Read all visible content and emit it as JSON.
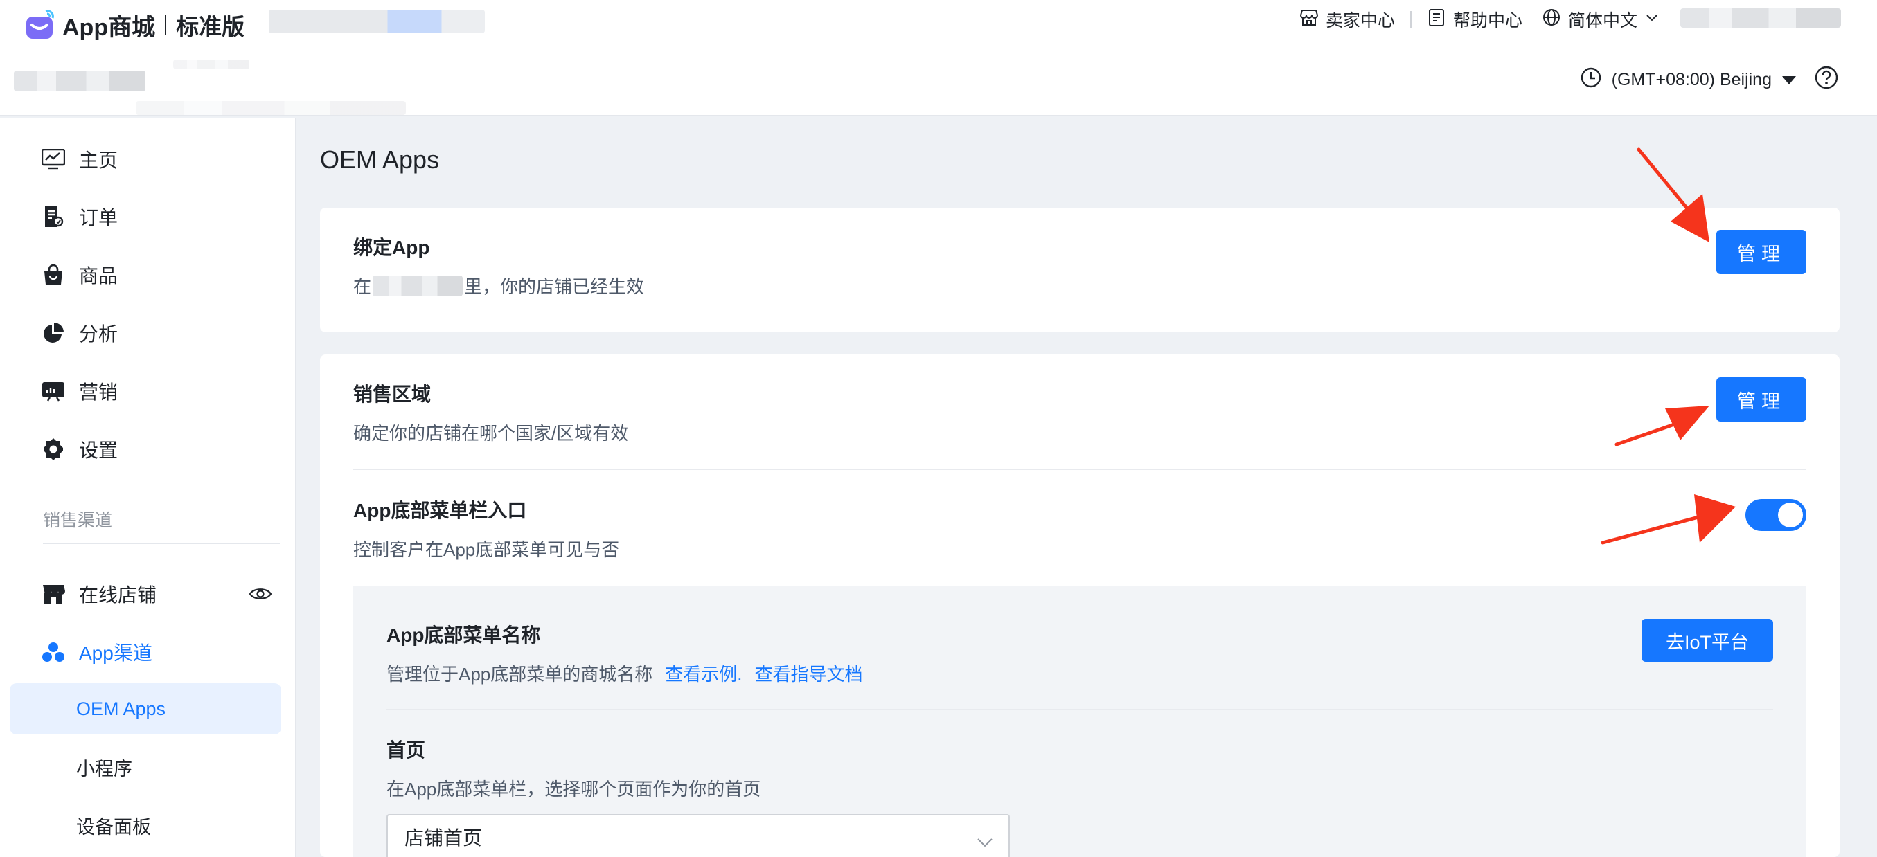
{
  "brand": {
    "name": "App商城",
    "edition": "标准版",
    "accent": "#1677ff"
  },
  "header": {
    "links": [
      {
        "icon": "store-icon",
        "label": "卖家中心"
      },
      {
        "icon": "document-icon",
        "label": "帮助中心"
      },
      {
        "icon": "globe-icon",
        "label": "简体中文"
      }
    ],
    "timezone": "(GMT+08:00) Beijing"
  },
  "sidebar": {
    "items": [
      {
        "icon": "dashboard-icon",
        "label": "主页"
      },
      {
        "icon": "orders-icon",
        "label": "订单"
      },
      {
        "icon": "bag-icon",
        "label": "商品"
      },
      {
        "icon": "pie-chart-icon",
        "label": "分析"
      },
      {
        "icon": "marketing-icon",
        "label": "营销"
      },
      {
        "icon": "gear-icon",
        "label": "设置"
      }
    ],
    "section_label": "销售渠道",
    "channels": [
      {
        "icon": "shop-icon",
        "label": "在线店铺"
      },
      {
        "icon": "app-channel-icon",
        "label": "App渠道"
      }
    ],
    "sub_items": [
      {
        "label": "OEM Apps",
        "active": true
      },
      {
        "label": "小程序",
        "active": false
      },
      {
        "label": "设备面板",
        "active": false
      }
    ]
  },
  "main": {
    "title": "OEM Apps",
    "bind_app": {
      "title": "绑定App",
      "desc_prefix": "在",
      "desc_suffix": "里，你的店铺已经生效",
      "button": "管理"
    },
    "sales_region": {
      "title": "销售区域",
      "desc": "确定你的店铺在哪个国家/区域有效",
      "button": "管理"
    },
    "bottom_menu_entry": {
      "title": "App底部菜单栏入口",
      "desc": "控制客户在App底部菜单可见与否",
      "enabled": true
    },
    "bottom_menu_name": {
      "title": "App底部菜单名称",
      "desc": "管理位于App底部菜单的商城名称",
      "link_example": "查看示例.",
      "link_docs": "查看指导文档",
      "button": "去IoT平台"
    },
    "homepage": {
      "title": "首页",
      "desc": "在App底部菜单栏，选择哪个页面作为你的首页",
      "selected": "店铺首页"
    }
  },
  "annotation_color": "#f5341c"
}
